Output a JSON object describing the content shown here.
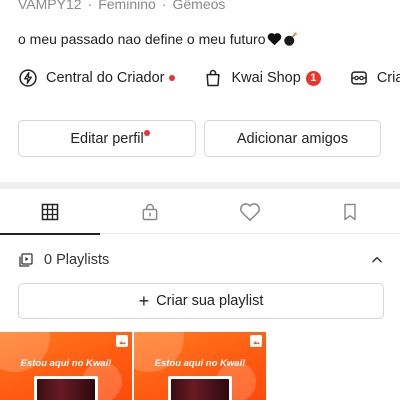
{
  "profile": {
    "username": "VAMPY12",
    "separator": "·",
    "gender": "Feminino",
    "sign": "Gêmeos",
    "bio": "o meu passado nao define o meu futuro"
  },
  "shortcuts": {
    "creator": "Central do Criador",
    "shop": "Kwai Shop",
    "shop_badge": "1",
    "third": "Cria"
  },
  "buttons": {
    "edit_profile": "Editar perfil",
    "add_friends": "Adicionar amigos"
  },
  "tabs": [
    {
      "icon": "grid-icon",
      "active": true
    },
    {
      "icon": "lock-icon",
      "active": false
    },
    {
      "icon": "heart-icon",
      "active": false
    },
    {
      "icon": "bookmark-icon",
      "active": false
    }
  ],
  "playlists": {
    "label": "0 Playlists",
    "create_plus": "+",
    "create_label": "Criar sua playlist"
  },
  "thumbnails": [
    {
      "headline": "Estou aqui no Kwai!"
    },
    {
      "headline": "Estou aqui no Kwai!"
    }
  ],
  "colors": {
    "accent_red": "#f0322c",
    "thumb_orange": "#ff5a10",
    "text": "#222222",
    "muted": "#8a8a8a"
  }
}
